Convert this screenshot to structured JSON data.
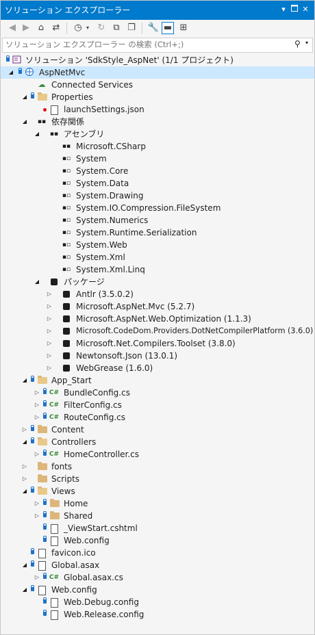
{
  "window": {
    "title": "ソリューション エクスプローラー",
    "controls": [
      "dropdown-icon",
      "maximize-icon",
      "close-icon"
    ]
  },
  "toolbar": {
    "icons": [
      "back-icon",
      "forward-icon",
      "home-icon",
      "switch-views-icon",
      "history-icon",
      "sync-icon",
      "collapse-all-icon",
      "show-all-files-icon",
      "properties-icon",
      "preview-selected-icon",
      "class-view-icon"
    ]
  },
  "search": {
    "placeholder": "ソリューション エクスプローラー の検索 (Ctrl+;)"
  },
  "tree": {
    "solution": "ソリューション 'SdkStyle_AspNet' (1/1 プロジェクト)",
    "project": "AspNetMvc",
    "connected_services": "Connected Services",
    "properties": "Properties",
    "launch_settings": "launchSettings.json",
    "dependencies": "依存関係",
    "assemblies": "アセンブリ",
    "assembly_items": [
      "Microsoft.CSharp",
      "System",
      "System.Core",
      "System.Data",
      "System.Drawing",
      "System.IO.Compression.FileSystem",
      "System.Numerics",
      "System.Runtime.Serialization",
      "System.Web",
      "System.Xml",
      "System.Xml.Linq"
    ],
    "packages": "パッケージ",
    "package_items": [
      "Antlr (3.5.0.2)",
      "Microsoft.AspNet.Mvc (5.2.7)",
      "Microsoft.AspNet.Web.Optimization (1.1.3)",
      "Microsoft.CodeDom.Providers.DotNetCompilerPlatform (3.6.0)",
      "Microsoft.Net.Compilers.Toolset (3.8.0)",
      "Newtonsoft.Json (13.0.1)",
      "WebGrease (1.6.0)"
    ],
    "app_start": "App_Start",
    "app_start_items": [
      "BundleConfig.cs",
      "FilterConfig.cs",
      "RouteConfig.cs"
    ],
    "content": "Content",
    "controllers": "Controllers",
    "home_controller": "HomeController.cs",
    "fonts": "fonts",
    "scripts": "Scripts",
    "views": "Views",
    "views_home": "Home",
    "views_shared": "Shared",
    "viewstart": "_ViewStart.cshtml",
    "views_webconfig": "Web.config",
    "favicon": "favicon.ico",
    "global_asax": "Global.asax",
    "global_asax_cs": "Global.asax.cs",
    "web_config": "Web.config",
    "web_debug": "Web.Debug.config",
    "web_release": "Web.Release.config"
  },
  "colors": {
    "titlebar": "#007acc",
    "selection": "#cce8ff",
    "csharp": "#388a34",
    "folder": "#dcb67a",
    "lock": "#1e72c9"
  }
}
